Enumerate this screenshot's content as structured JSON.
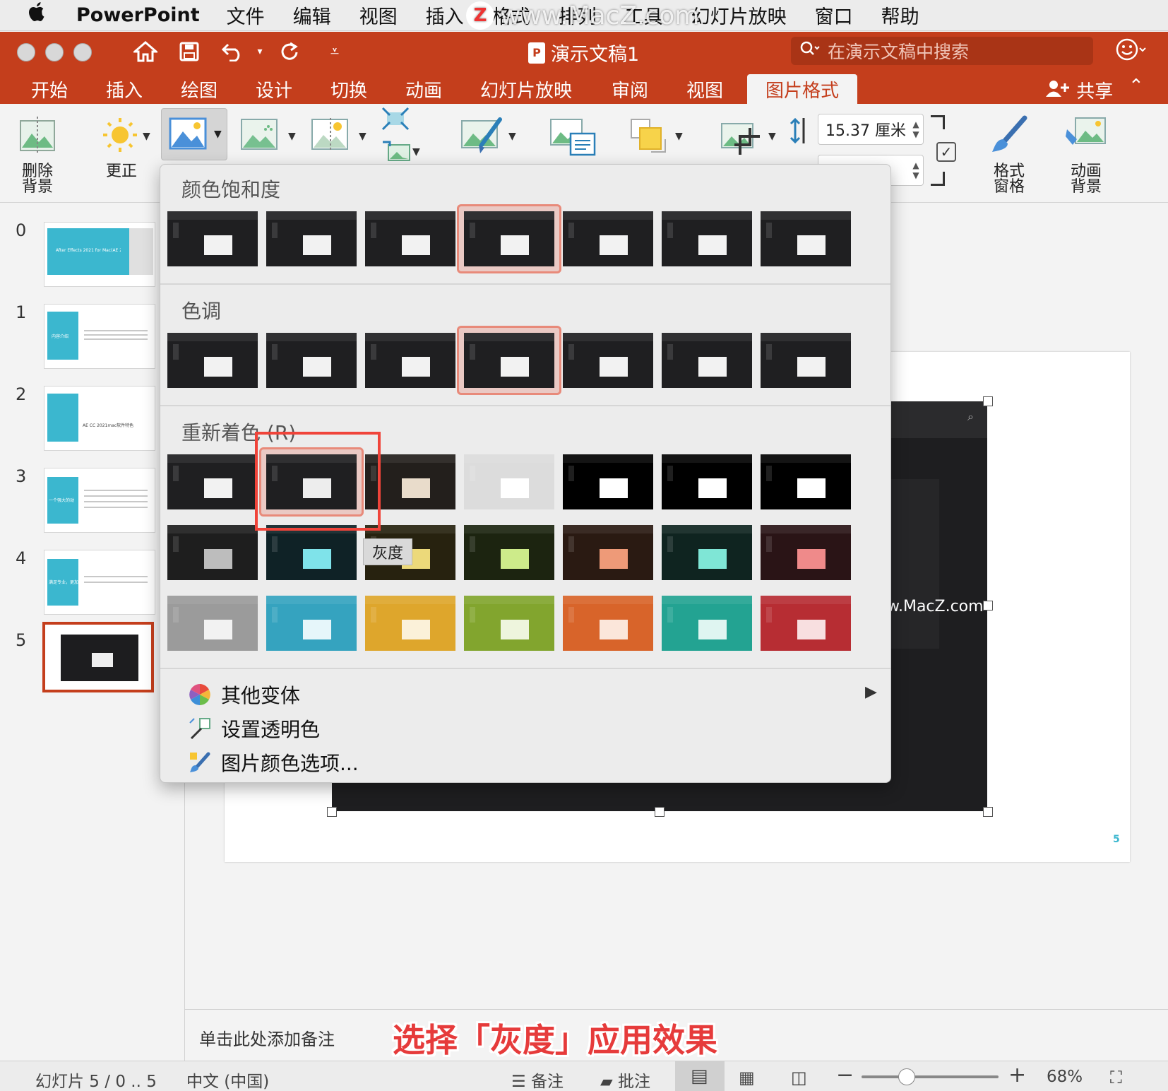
{
  "menubar": {
    "apple": "",
    "app": "PowerPoint",
    "items": [
      "文件",
      "编辑",
      "视图",
      "插入",
      "格式",
      "排列",
      "工具",
      "幻灯片放映",
      "窗口",
      "帮助"
    ],
    "watermark": "www.MacZ.com"
  },
  "titlebar": {
    "doc_title": "演示文稿1",
    "search_placeholder": "在演示文稿中搜索"
  },
  "tabs": [
    "开始",
    "插入",
    "绘图",
    "设计",
    "切换",
    "动画",
    "幻灯片放映",
    "审阅",
    "视图",
    "图片格式"
  ],
  "active_tab": "图片格式",
  "share_label": "共享",
  "ribbon": {
    "remove_bg": "删除\n背景",
    "corrections": "更正",
    "height_value": "15.37 厘米",
    "format_pane": "格式\n窗格",
    "animate_bg": "动画\n背景"
  },
  "slides": {
    "numbers": [
      "0",
      "1",
      "2",
      "3",
      "4",
      "5"
    ],
    "thumb_text": [
      "After Effects 2021 for Mac(AE 2020)",
      "内容介绍",
      "AE CC 2021mac软件特色",
      "一个强大的动",
      "满足专业，更加"
    ]
  },
  "menu": {
    "section_saturation": "颜色饱和度",
    "section_tone": "色调",
    "section_recolor": "重新着色 (R)",
    "tooltip": "灰度",
    "more_variants": "其他变体",
    "set_transparent": "设置透明色",
    "picture_color_options": "图片颜色选项..."
  },
  "slide_page_number": "5",
  "slide_watermark": "w.MacZ.com",
  "notes_placeholder": "单击此处添加备注",
  "caption": "选择「灰度」应用效果",
  "status": {
    "slide_counter": "幻灯片 5 / 0 .. 5",
    "language": "中文 (中国)",
    "notes_btn": "备注",
    "comments_btn": "批注",
    "zoom": "68%"
  },
  "colors": {
    "accent": "#c43e1c",
    "slide_accent": "#3bb7cf",
    "highlight": "#f0443a"
  }
}
